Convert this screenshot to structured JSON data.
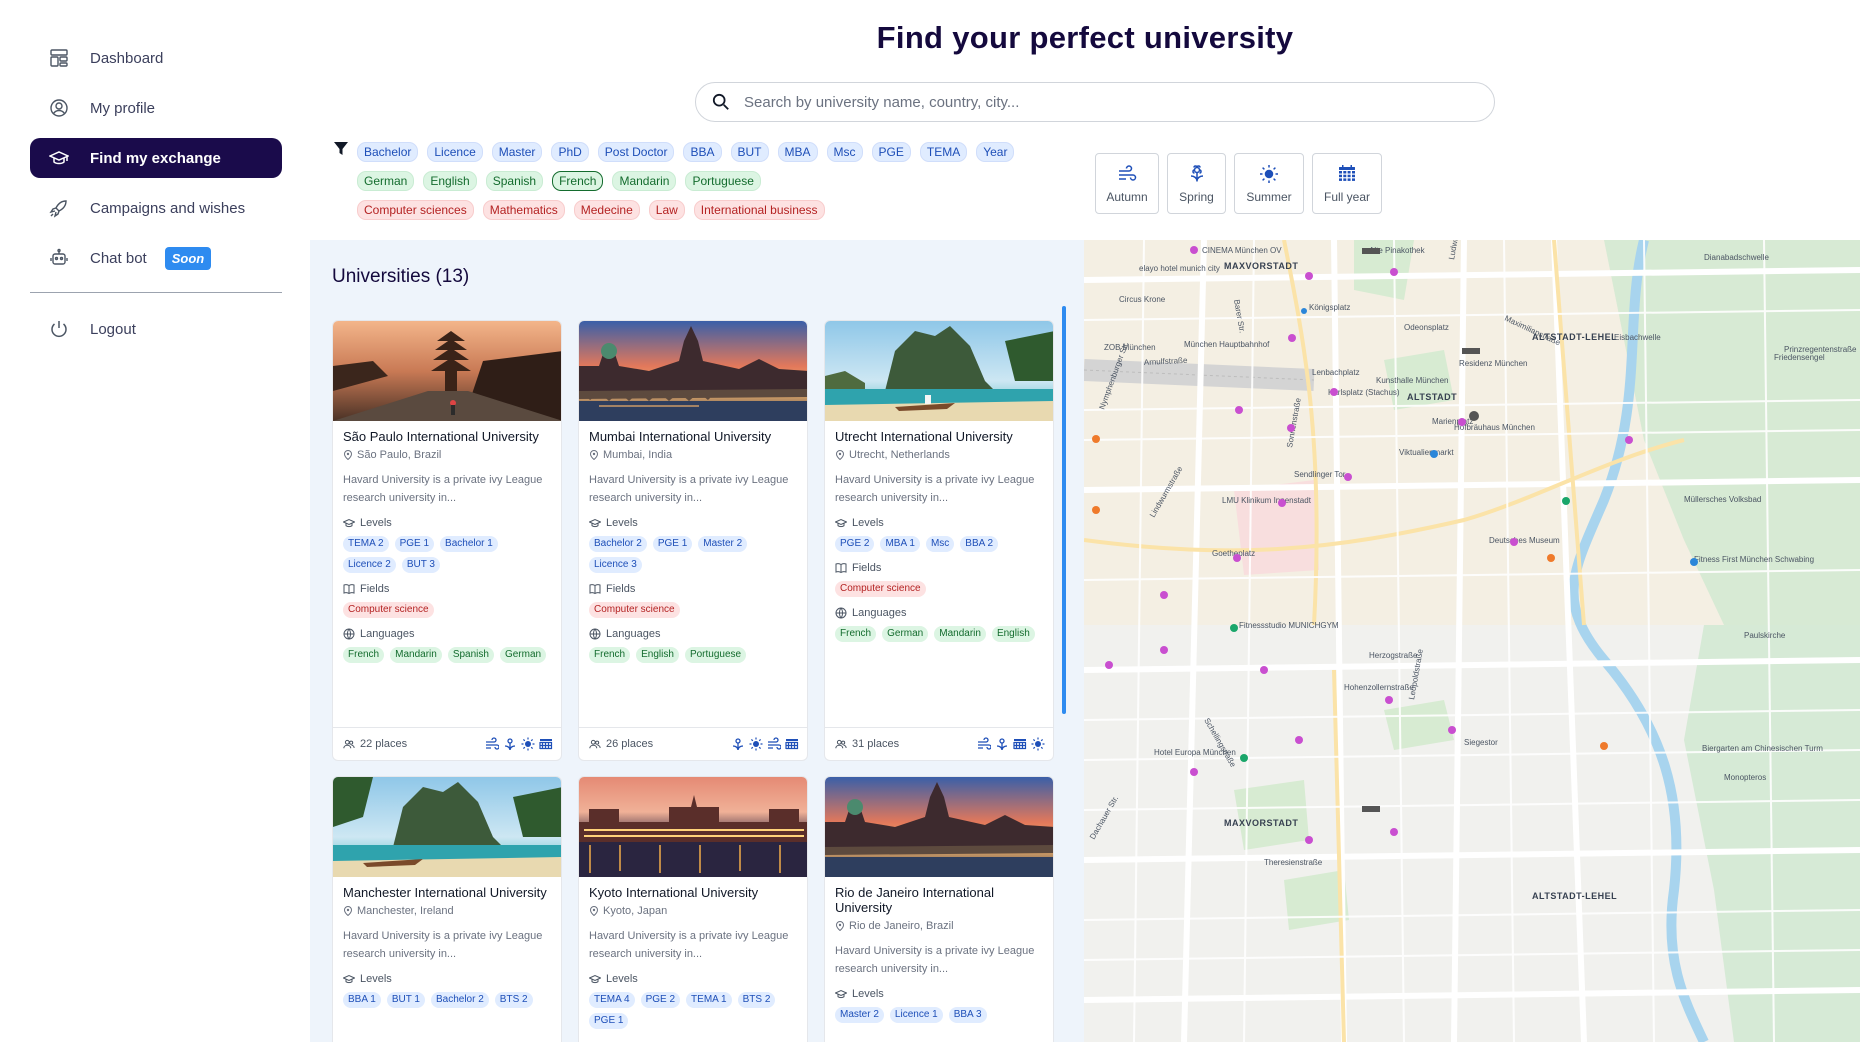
{
  "sidebar": {
    "items": [
      {
        "label": "Dashboard",
        "icon": "dashboard-icon"
      },
      {
        "label": "My profile",
        "icon": "profile-icon"
      },
      {
        "label": "Find my exchange",
        "icon": "graduation-cap-icon",
        "active": true
      },
      {
        "label": "Campaigns and wishes",
        "icon": "rocket-icon"
      },
      {
        "label": "Chat bot",
        "icon": "robot-icon",
        "badge": "Soon"
      }
    ],
    "logout": {
      "label": "Logout",
      "icon": "power-icon"
    }
  },
  "header": {
    "title": "Find your perfect university",
    "search_placeholder": "Search by university name, country, city..."
  },
  "filters": {
    "levels": [
      "Bachelor",
      "Licence",
      "Master",
      "PhD",
      "Post Doctor",
      "BBA",
      "BUT",
      "MBA",
      "Msc",
      "PGE",
      "TEMA",
      "Year"
    ],
    "languages": [
      "German",
      "English",
      "Spanish",
      "French",
      "Mandarin",
      "Portuguese"
    ],
    "selected_language": "French",
    "fields": [
      "Computer sciences",
      "Mathematics",
      "Medecine",
      "Law",
      "International business"
    ],
    "seasons": [
      {
        "label": "Autumn",
        "icon": "wind-icon"
      },
      {
        "label": "Spring",
        "icon": "flower-icon"
      },
      {
        "label": "Summer",
        "icon": "sun-icon"
      },
      {
        "label": "Full year",
        "icon": "calendar-icon"
      }
    ]
  },
  "list": {
    "title": "Universities (13)",
    "labels": {
      "levels": "Levels",
      "fields": "Fields",
      "languages": "Languages"
    },
    "cards": [
      {
        "name": "São Paulo International University",
        "location": "São Paulo, Brazil",
        "description": "Havard University is a private ivy League research university in...",
        "levels": [
          "TEMA 2",
          "PGE 1",
          "Bachelor 1",
          "Licence 2",
          "BUT 3"
        ],
        "fields": [
          "Computer science"
        ],
        "languages": [
          "French",
          "Mandarin",
          "Spanish",
          "German"
        ],
        "places": "22 places",
        "seasons": [
          "wind",
          "flower",
          "sun",
          "calendar"
        ],
        "image": "kyoto"
      },
      {
        "name": "Mumbai International University",
        "location": "Mumbai, India",
        "description": "Havard University is a private ivy League research university in...",
        "levels": [
          "Bachelor 2",
          "PGE 1",
          "Master 2",
          "Licence 3"
        ],
        "fields": [
          "Computer science"
        ],
        "languages": [
          "French",
          "English",
          "Portuguese"
        ],
        "places": "26 places",
        "seasons": [
          "flower",
          "sun",
          "wind",
          "calendar"
        ],
        "image": "prague"
      },
      {
        "name": "Utrecht International University",
        "location": "Utrecht, Netherlands",
        "description": "Havard University is a private ivy League research university in...",
        "levels": [
          "PGE 2",
          "MBA 1",
          "Msc",
          "BBA 2"
        ],
        "fields": [
          "Computer science"
        ],
        "languages": [
          "French",
          "German",
          "Mandarin",
          "English"
        ],
        "places": "31 places",
        "seasons": [
          "wind",
          "flower",
          "calendar",
          "sun"
        ],
        "image": "beach"
      },
      {
        "name": "Manchester International University",
        "location": "Manchester, Ireland",
        "description": "Havard University is a private ivy League research university in...",
        "levels": [
          "BBA 1",
          "BUT 1",
          "Bachelor 2",
          "BTS 2"
        ],
        "image": "beach"
      },
      {
        "name": "Kyoto International University",
        "location": "Kyoto, Japan",
        "description": "Havard University is a private ivy League research university in...",
        "levels": [
          "TEMA 4",
          "PGE 2",
          "TEMA 1",
          "BTS 2",
          "PGE 1"
        ],
        "image": "budapest"
      },
      {
        "name": "Rio de Janeiro International University",
        "location": "Rio de Janeiro, Brazil",
        "description": "Havard University is a private ivy League research university in...",
        "levels": [
          "Master 2",
          "Licence 1",
          "BBA 3"
        ],
        "image": "prague"
      }
    ]
  },
  "map": {
    "districts": [
      "MAXVORSTADT",
      "ALTSTADT-LEHEL",
      "ALTSTADT",
      "MAXVORSTADT",
      "ALTSTADT-LEHEL"
    ],
    "places": [
      "CINEMA München OV",
      "Alte Pinakothek",
      "elayo hotel munich city",
      "Königsplatz",
      "Circus Krone",
      "München Hauptbahnhof",
      "ZOB München",
      "Odeonsplatz",
      "Residenz München",
      "Lenbachplatz",
      "Karlsplatz (Stachus)",
      "Marienplatz",
      "Hofbräuhaus München",
      "Viktualienmarkt",
      "Sendlinger Tor",
      "LMU Klinikum Innenstadt",
      "Deutsches Museum",
      "Kunsthalle München",
      "Eisbachwelle",
      "Friedensengel",
      "Müllersches Volksbad",
      "Goetheplatz",
      "Fitness First München Schwabing",
      "Fitnessstudio MUNICHGYM",
      "Paulskirche",
      "Hotel Europa München",
      "Siegestor",
      "Dianabadschwelle",
      "Biergarten am Chinesischen Turm",
      "Monopteros"
    ],
    "streets": [
      "Arnulfstraße",
      "Sonnenstraße",
      "Lindwurmstraße",
      "Maximilianstraße",
      "Ludwigstraße",
      "Leopoldstraße",
      "Schellingstraße",
      "Theresienstraße",
      "Prinzregentenstraße",
      "Herzogstraße",
      "Hohenzollernstraße",
      "Nymphenburger Str.",
      "Dachauer Str.",
      "Barer Str."
    ]
  }
}
